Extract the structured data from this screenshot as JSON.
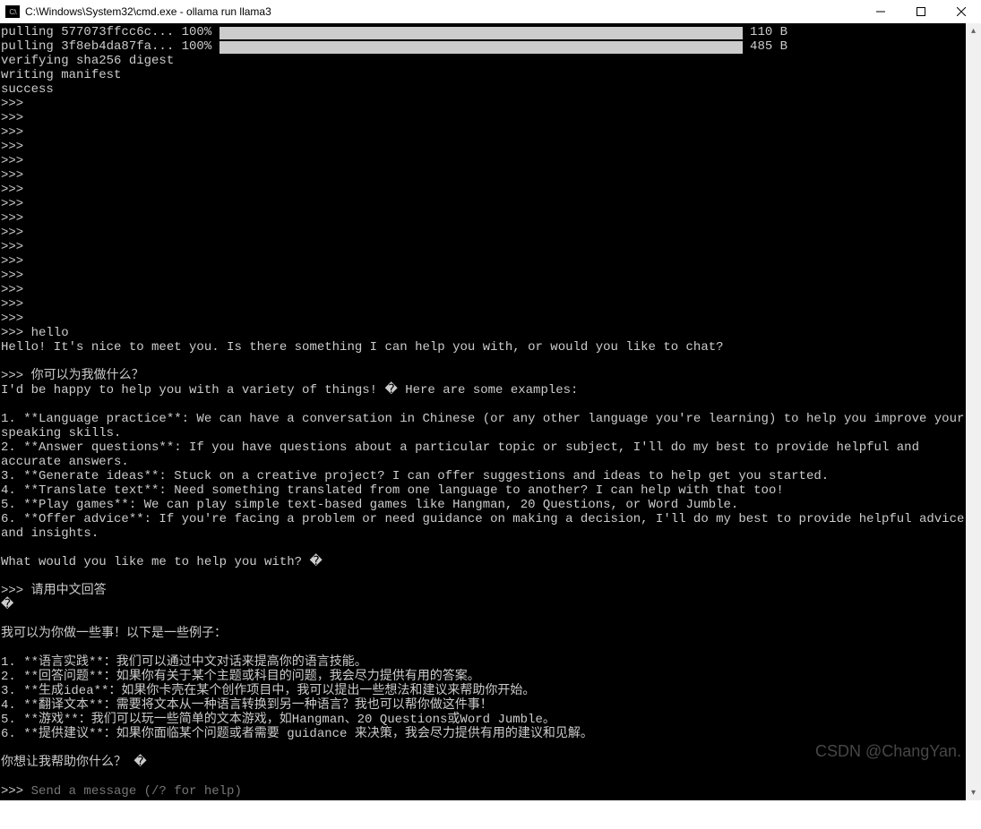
{
  "titlebar": {
    "icon_label": "C:\\",
    "title": "C:\\Windows\\System32\\cmd.exe - ollama  run llama3"
  },
  "progress": {
    "line1_prefix": "pulling 577073ffcc6c... 100% ",
    "line1_suffix": " 110 B",
    "line2_prefix": "pulling 3f8eb4da87fa... 100% ",
    "line2_suffix": " 485 B"
  },
  "startup": {
    "verify": "verifying sha256 digest",
    "manifest": "writing manifest",
    "success": "success"
  },
  "prompts": {
    "p": ">>>",
    "empty_count_block1": 16
  },
  "convo": {
    "user1": ">>> hello",
    "reply1": "Hello! It's nice to meet you. Is there something I can help you with, or would you like to chat?",
    "user2": ">>> 你可以为我做什么？",
    "reply2_intro": "I'd be happy to help you with a variety of things! � Here are some examples:",
    "reply2_items": [
      "1. **Language practice**: We can have a conversation in Chinese (or any other language you're learning) to help you improve your",
      "speaking skills.",
      "2. **Answer questions**: If you have questions about a particular topic or subject, I'll do my best to provide helpful and",
      "accurate answers.",
      "3. **Generate ideas**: Stuck on a creative project? I can offer suggestions and ideas to help get you started.",
      "4. **Translate text**: Need something translated from one language to another? I can help with that too!",
      "5. **Play games**: We can play simple text-based games like Hangman, 20 Questions, or Word Jumble.",
      "6. **Offer advice**: If you're facing a problem or need guidance on making a decision, I'll do my best to provide helpful advice",
      "and insights."
    ],
    "reply2_outro": "What would you like me to help you with? �",
    "user3": ">>> 请用中文回答",
    "reply3_char": "�",
    "reply3_intro": "我可以为你做一些事！以下是一些例子：",
    "reply3_items": [
      "1. **语言实践**：我们可以通过中文对话来提高你的语言技能。",
      "2. **回答问题**：如果你有关于某个主题或科目的问题，我会尽力提供有用的答案。",
      "3. **生成idea**：如果你卡壳在某个创作项目中，我可以提出一些想法和建议来帮助你开始。",
      "4. **翻译文本**：需要将文本从一种语言转换到另一种语言？我也可以帮你做这件事！",
      "5. **游戏**：我们可以玩一些简单的文本游戏，如Hangman、20 Questions或Word Jumble。",
      "6. **提供建议**：如果你面临某个问题或者需要 guidance 来决策，我会尽力提供有用的建议和见解。"
    ],
    "reply3_outro": "你想让我帮助你什么？ �"
  },
  "input": {
    "prefix": ">>> ",
    "placeholder": "Send a message (/? for help)"
  },
  "watermark": "CSDN @ChangYan."
}
